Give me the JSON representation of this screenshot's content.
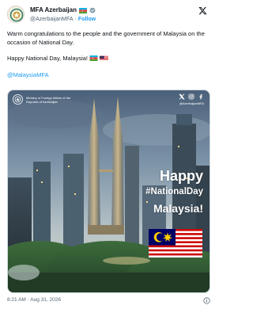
{
  "author": {
    "name": "MFA Azerbaijan",
    "handle": "@AzerbaijanMFA",
    "separator": "·",
    "follow_label": "Follow"
  },
  "tweet": {
    "line1": "Warm congratulations to the people and the government of Malaysia on the occasion of National Day.",
    "line2": "Happy National Day, Malaysia!",
    "mention": "@MalaysiaMFA"
  },
  "media": {
    "ministry_name": "Ministry of Foreign Affairs of the Republic of Azerbaijan",
    "social_handle": "@AzerbaijanMFA",
    "greeting_1": "Happy",
    "greeting_2": "#NationalDay",
    "greeting_3": "Malaysia!"
  },
  "footer": {
    "timestamp": "8:21 AM · Aug 31, 2026"
  },
  "icons": {
    "x_logo": "x-logo-icon",
    "verified": "verified-badge-icon",
    "info": "info-icon"
  },
  "colors": {
    "link": "#1d9bf0",
    "text": "#0f1419",
    "muted": "#536471",
    "malaysia_blue": "#010066",
    "malaysia_red": "#cc0001",
    "malaysia_yellow": "#ffcc00"
  }
}
